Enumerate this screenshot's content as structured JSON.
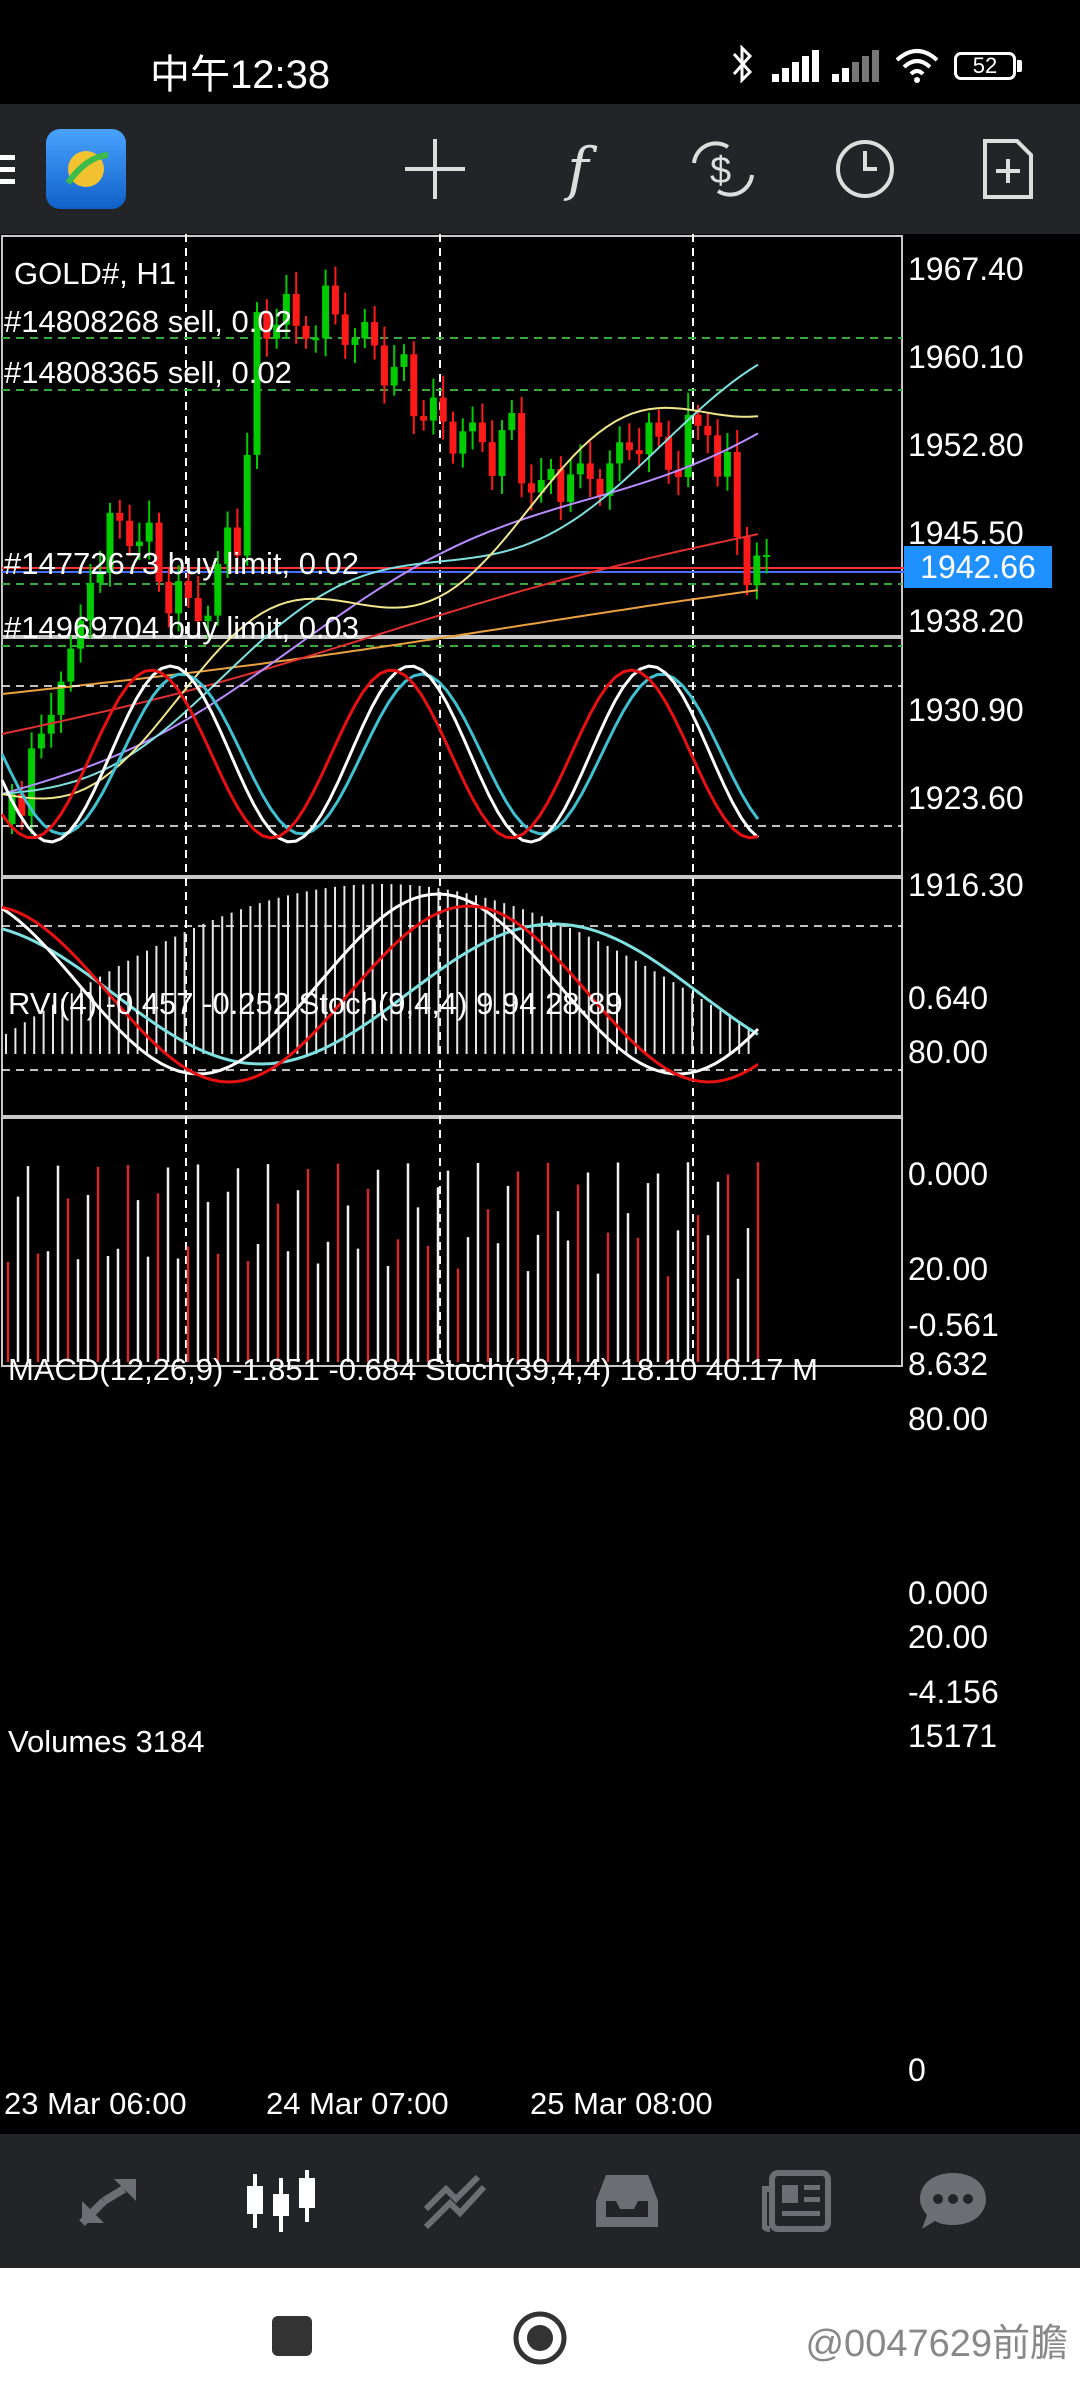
{
  "status_bar": {
    "time": "中午12:38",
    "battery": "52"
  },
  "toolbar": {
    "icons": [
      "hamburger-menu-icon",
      "metatrader-logo-icon",
      "crosshair-icon",
      "function-f-icon",
      "symbol-dollar-icon",
      "clock-icon",
      "add-document-icon"
    ]
  },
  "chart": {
    "symbol_label": "GOLD#, H1",
    "orders": [
      "#14808268 sell, 0.02",
      "#14808365 sell, 0.02",
      "#14772673 buy limit, 0.02",
      "#14969704 buy limit, 0.03"
    ],
    "price_axis": [
      "1967.40",
      "1960.10",
      "1952.80",
      "1945.50",
      "1938.20",
      "1930.90",
      "1923.60",
      "1916.30"
    ],
    "current_price": "1942.66",
    "rvi_label": "RVI(4) -0.457 -0.252 Stoch(9,4,4) 9.94 28.89",
    "rvi_axis": [
      "0.640",
      "80.00",
      "0.000",
      "20.00",
      "-0.561"
    ],
    "macd_label": "MACD(12,26,9) -1.851 -0.684 Stoch(39,4,4) 18.10 40.17 M",
    "macd_axis": [
      "8.632",
      "80.00",
      "0.000",
      "20.00",
      "-4.156"
    ],
    "volume_label": "Volumes 3184",
    "volume_axis": [
      "15171",
      "0"
    ],
    "time_axis": [
      "23 Mar 06:00",
      "24 Mar 07:00",
      "25 Mar 08:00"
    ],
    "colors": {
      "bull": "#00cc00",
      "bear": "#ff1a1a",
      "price_tag": "#1e90ff",
      "toolbar_bg": "#222427"
    }
  },
  "bottom_nav": {
    "items": [
      "quotes-icon",
      "chart-icon",
      "trade-icon",
      "history-icon",
      "news-icon",
      "chat-icon"
    ]
  },
  "system_nav": {
    "watermark": "@0047629前膽"
  }
}
